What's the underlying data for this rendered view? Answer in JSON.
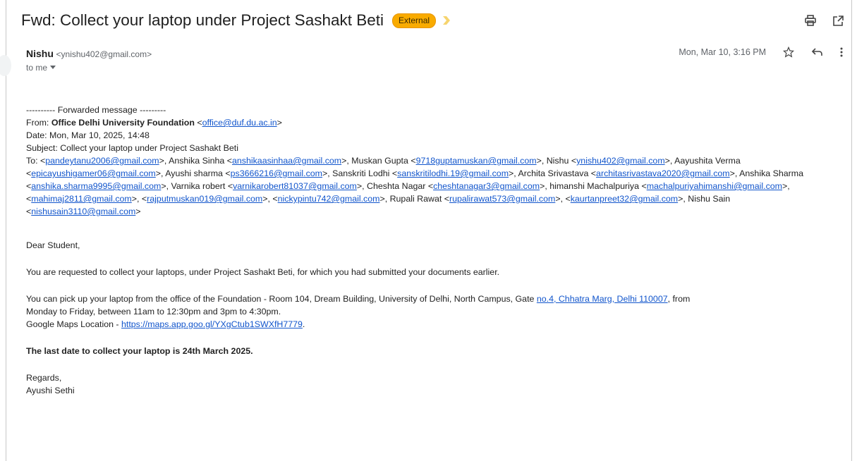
{
  "header": {
    "subject": "Fwd: Collect your laptop under Project Sashakt Beti",
    "badge": "External"
  },
  "sender": {
    "name": "Nishu",
    "email": "<ynishu402@gmail.com>",
    "to_label": "to me",
    "date": "Mon, Mar 10, 3:16 PM"
  },
  "forwarded": {
    "banner": "---------- Forwarded message ---------",
    "from_label": "From:",
    "from_name": "Office Delhi University Foundation",
    "from_email": "office@duf.du.ac.in",
    "date_line": "Date: Mon, Mar 10, 2025, 14:48",
    "subject_line": "Subject: Collect your laptop under Project Sashakt Beti",
    "to_label": "To:",
    "recipients": [
      {
        "name": "",
        "email": "pandeytanu2006@gmail.com"
      },
      {
        "name": "Anshika Sinha",
        "email": "anshikaasinhaa@gmail.com"
      },
      {
        "name": "Muskan Gupta",
        "email": "9718guptamuskan@gmail.com"
      },
      {
        "name": "Nishu",
        "email": "ynishu402@gmail.com"
      },
      {
        "name": "Aayushita Verma",
        "email": "epicayushigamer06@gmail.com"
      },
      {
        "name": "Ayushi sharma",
        "email": "ps3666216@gmail.com"
      },
      {
        "name": "Sanskriti Lodhi",
        "email": "sanskritilodhi.19@gmail.com"
      },
      {
        "name": "Archita Srivastava",
        "email": "architasrivastava2020@gmail.com"
      },
      {
        "name": "Anshika Sharma",
        "email": "anshika.sharma9995@gmail.com"
      },
      {
        "name": "Varnika robert",
        "email": "varnikarobert81037@gmail.com"
      },
      {
        "name": "Cheshta Nagar",
        "email": "cheshtanagar3@gmail.com"
      },
      {
        "name": "himanshi Machalpuriya",
        "email": "machalpuriyahimanshi@gmail.com"
      },
      {
        "name": "",
        "email": "mahimaj2811@gmail.com"
      },
      {
        "name": "",
        "email": "rajputmuskan019@gmail.com"
      },
      {
        "name": "",
        "email": "nickypintu742@gmail.com"
      },
      {
        "name": "Rupali Rawat",
        "email": "rupalirawat573@gmail.com"
      },
      {
        "name": "",
        "email": "kaurtanpreet32@gmail.com"
      },
      {
        "name": "Nishu Sain",
        "email": "nishusain3110@gmail.com"
      }
    ]
  },
  "message": {
    "greeting": "Dear Student,",
    "para1": "You are requested to collect your laptops, under Project Sashakt Beti, for which you had submitted your documents earlier.",
    "para2_a": "You can pick up your laptop from the office of the Foundation - Room 104, Dream Building, University of Delhi, North Campus, Gate ",
    "para2_link": "no.4, Chhatra Marg, Delhi 110007",
    "para2_b": ", from",
    "para2_line2": "Monday to Friday, between 11am to 12:30pm and 3pm to 4:30pm.",
    "maps_label": "Google Maps Location - ",
    "maps_link": "https://maps.app.goo.gl/YXgCtub1SWXfH7779",
    "maps_end": ".",
    "deadline": "The last date to collect your laptop is 24th March 2025.",
    "regards": "Regards,",
    "signature": "Ayushi Sethi"
  },
  "colors": {
    "link": "#1155cc",
    "badge": "#f9ab00"
  },
  "icons": [
    "importance-marker-icon",
    "print-icon",
    "open-in-new-window-icon",
    "star-icon",
    "reply-icon",
    "more-vert-icon",
    "dropdown-arrow-icon"
  ]
}
